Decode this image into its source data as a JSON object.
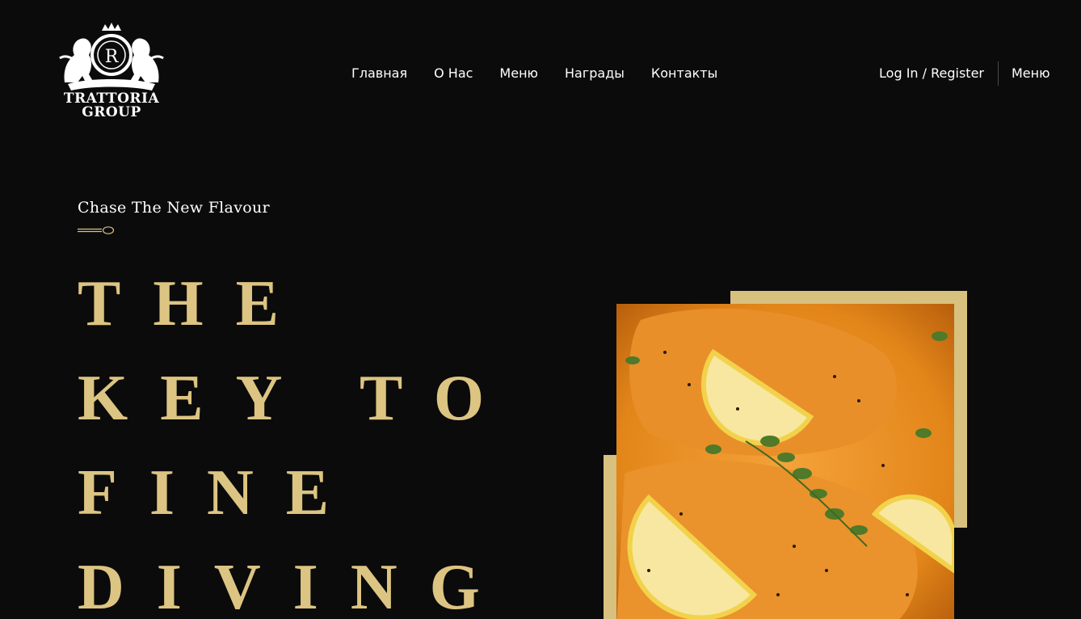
{
  "brand": {
    "line1": "TRATTORIA",
    "line2": "GROUP",
    "crest_monogram": "R"
  },
  "nav": {
    "items": [
      {
        "label": "Главная"
      },
      {
        "label": "О Нас"
      },
      {
        "label": "Меню"
      },
      {
        "label": "Награды"
      },
      {
        "label": "Контакты"
      }
    ],
    "auth_label": "Log In / Register",
    "menu_label": "Меню"
  },
  "hero": {
    "tagline": "Chase The New Flavour",
    "headline": [
      "THE",
      "KEY TO",
      "FINE",
      "DIVING"
    ]
  },
  "icons": {
    "logo": "lion-crest-icon",
    "tagline_divider": "spoon-icon"
  },
  "colors": {
    "background": "#0b0b0b",
    "gold": "#dcc482",
    "text": "#ffffff"
  }
}
